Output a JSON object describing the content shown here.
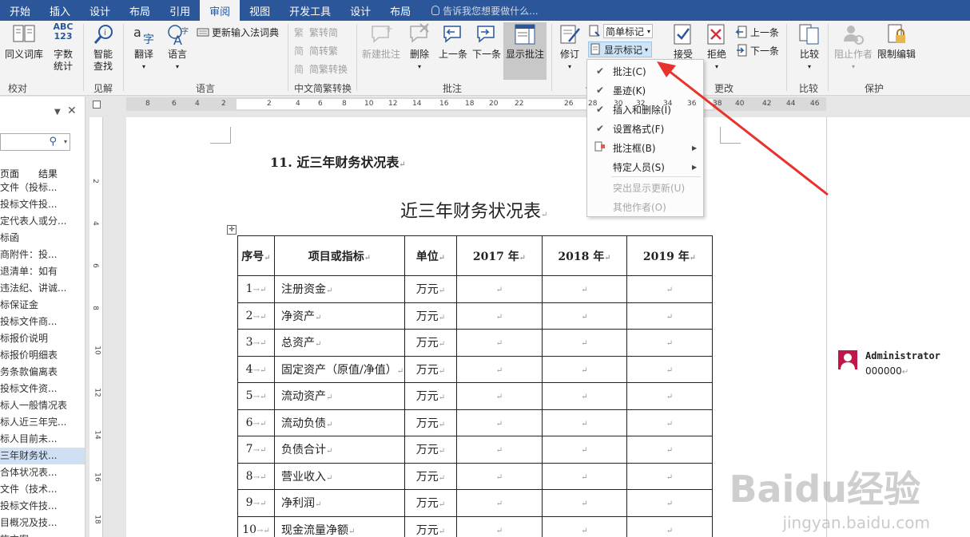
{
  "tabs": [
    "开始",
    "插入",
    "设计",
    "布局",
    "引用",
    "审阅",
    "视图",
    "开发工具",
    "设计",
    "布局"
  ],
  "active_tab": "审阅",
  "tellme": "告诉我您想要做什么...",
  "ribbon": {
    "proof": {
      "thesaurus": "同义词库",
      "wordcount_line1": "字数",
      "wordcount_line2": "统计",
      "wordcount_icon_text": "ABC\n123",
      "group": "校对"
    },
    "insights": {
      "smart_lookup_line1": "智能",
      "smart_lookup_line2": "查找",
      "group": "见解"
    },
    "language": {
      "translate": "翻译",
      "language": "语言",
      "update_ime": "更新输入法词典",
      "group": "语言"
    },
    "chinese": {
      "to_simplified": "繁转简",
      "to_traditional": "简转繁",
      "convert": "简繁转换",
      "group": "中文简繁转换"
    },
    "comments": {
      "new": "新建批注",
      "delete": "删除",
      "prev": "上一条",
      "next": "下一条",
      "show": "显示批注",
      "group": "批注"
    },
    "tracking": {
      "track": "修订",
      "simple_markup": "简单标记",
      "show_markup": "显示标记",
      "group": "修订"
    },
    "changes": {
      "accept": "接受",
      "reject": "拒绝",
      "prev": "上一条",
      "next": "下一条",
      "group": "更改"
    },
    "compare": {
      "compare": "比较",
      "group": "比较"
    },
    "protect": {
      "block_authors": "阻止作者",
      "restrict": "限制编辑",
      "group": "保护"
    }
  },
  "dropdown": {
    "items": [
      {
        "label": "批注(C)",
        "checked": true
      },
      {
        "label": "墨迹(K)",
        "checked": true
      },
      {
        "label": "插入和删除(I)",
        "checked": true
      },
      {
        "label": "设置格式(F)",
        "checked": true
      },
      {
        "label": "批注框(B)",
        "submenu": true
      },
      {
        "label": "特定人员(S)",
        "submenu": true
      },
      {
        "label": "突出显示更新(U)",
        "disabled": true
      },
      {
        "label": "其他作者(O)",
        "disabled": true
      }
    ]
  },
  "nav": {
    "tab_pages": "页面",
    "tab_results": "结果",
    "items": [
      "文件（投标...",
      "投标文件投...",
      "定代表人或分...",
      "标函",
      "商附件：投...",
      "退清单：如有",
      "违法纪、讲诚...",
      "标保证金",
      "投标文件商...",
      "标报价说明",
      "标报价明细表",
      "务条款偏离表",
      "投标文件资...",
      "标人一般情况表",
      "标人近三年完...",
      "标人目前未...",
      "三年财务状...",
      "合体状况表...",
      "文件（技术...",
      "投标文件技...",
      "目概况及技...",
      "施方案..."
    ],
    "selected_index": 16
  },
  "hruler_numbers": [
    "8",
    "6",
    "4",
    "2",
    "2",
    "4",
    "6",
    "8",
    "10",
    "12",
    "14",
    "16",
    "18",
    "20",
    "22",
    "26",
    "28",
    "30",
    "32",
    "34",
    "36",
    "38",
    "40",
    "42",
    "44",
    "46"
  ],
  "vruler_numbers": [
    "2",
    "4",
    "6",
    "8",
    "10",
    "12",
    "14",
    "16",
    "18"
  ],
  "doc": {
    "heading": "11. 近三年财务状况表",
    "title": "近三年财务状况表",
    "headers": [
      "序号",
      "项目或指标",
      "单位",
      "2017 年",
      "2018 年",
      "2019 年"
    ],
    "rows": [
      [
        "1",
        "注册资金",
        "万元"
      ],
      [
        "2",
        "净资产",
        "万元"
      ],
      [
        "3",
        "总资产",
        "万元"
      ],
      [
        "4",
        "固定资产（原值/净值）",
        "万元"
      ],
      [
        "5",
        "流动资产",
        "万元"
      ],
      [
        "6",
        "流动负债",
        "万元"
      ],
      [
        "7",
        "负债合计",
        "万元"
      ],
      [
        "8",
        "营业收入",
        "万元"
      ],
      [
        "9",
        "净利润",
        "万元"
      ],
      [
        "10",
        "现金流量净额",
        "万元"
      ]
    ]
  },
  "comment": {
    "author": "Administrator",
    "text": "000000"
  },
  "watermark": {
    "main": "Baidu经验",
    "url": "jingyan.baidu.com"
  },
  "colors": {
    "tabbar": "#2b579a",
    "accent_blue": "#2b579a",
    "arrow": "#e8322d",
    "author_icon": "#c0174b"
  }
}
